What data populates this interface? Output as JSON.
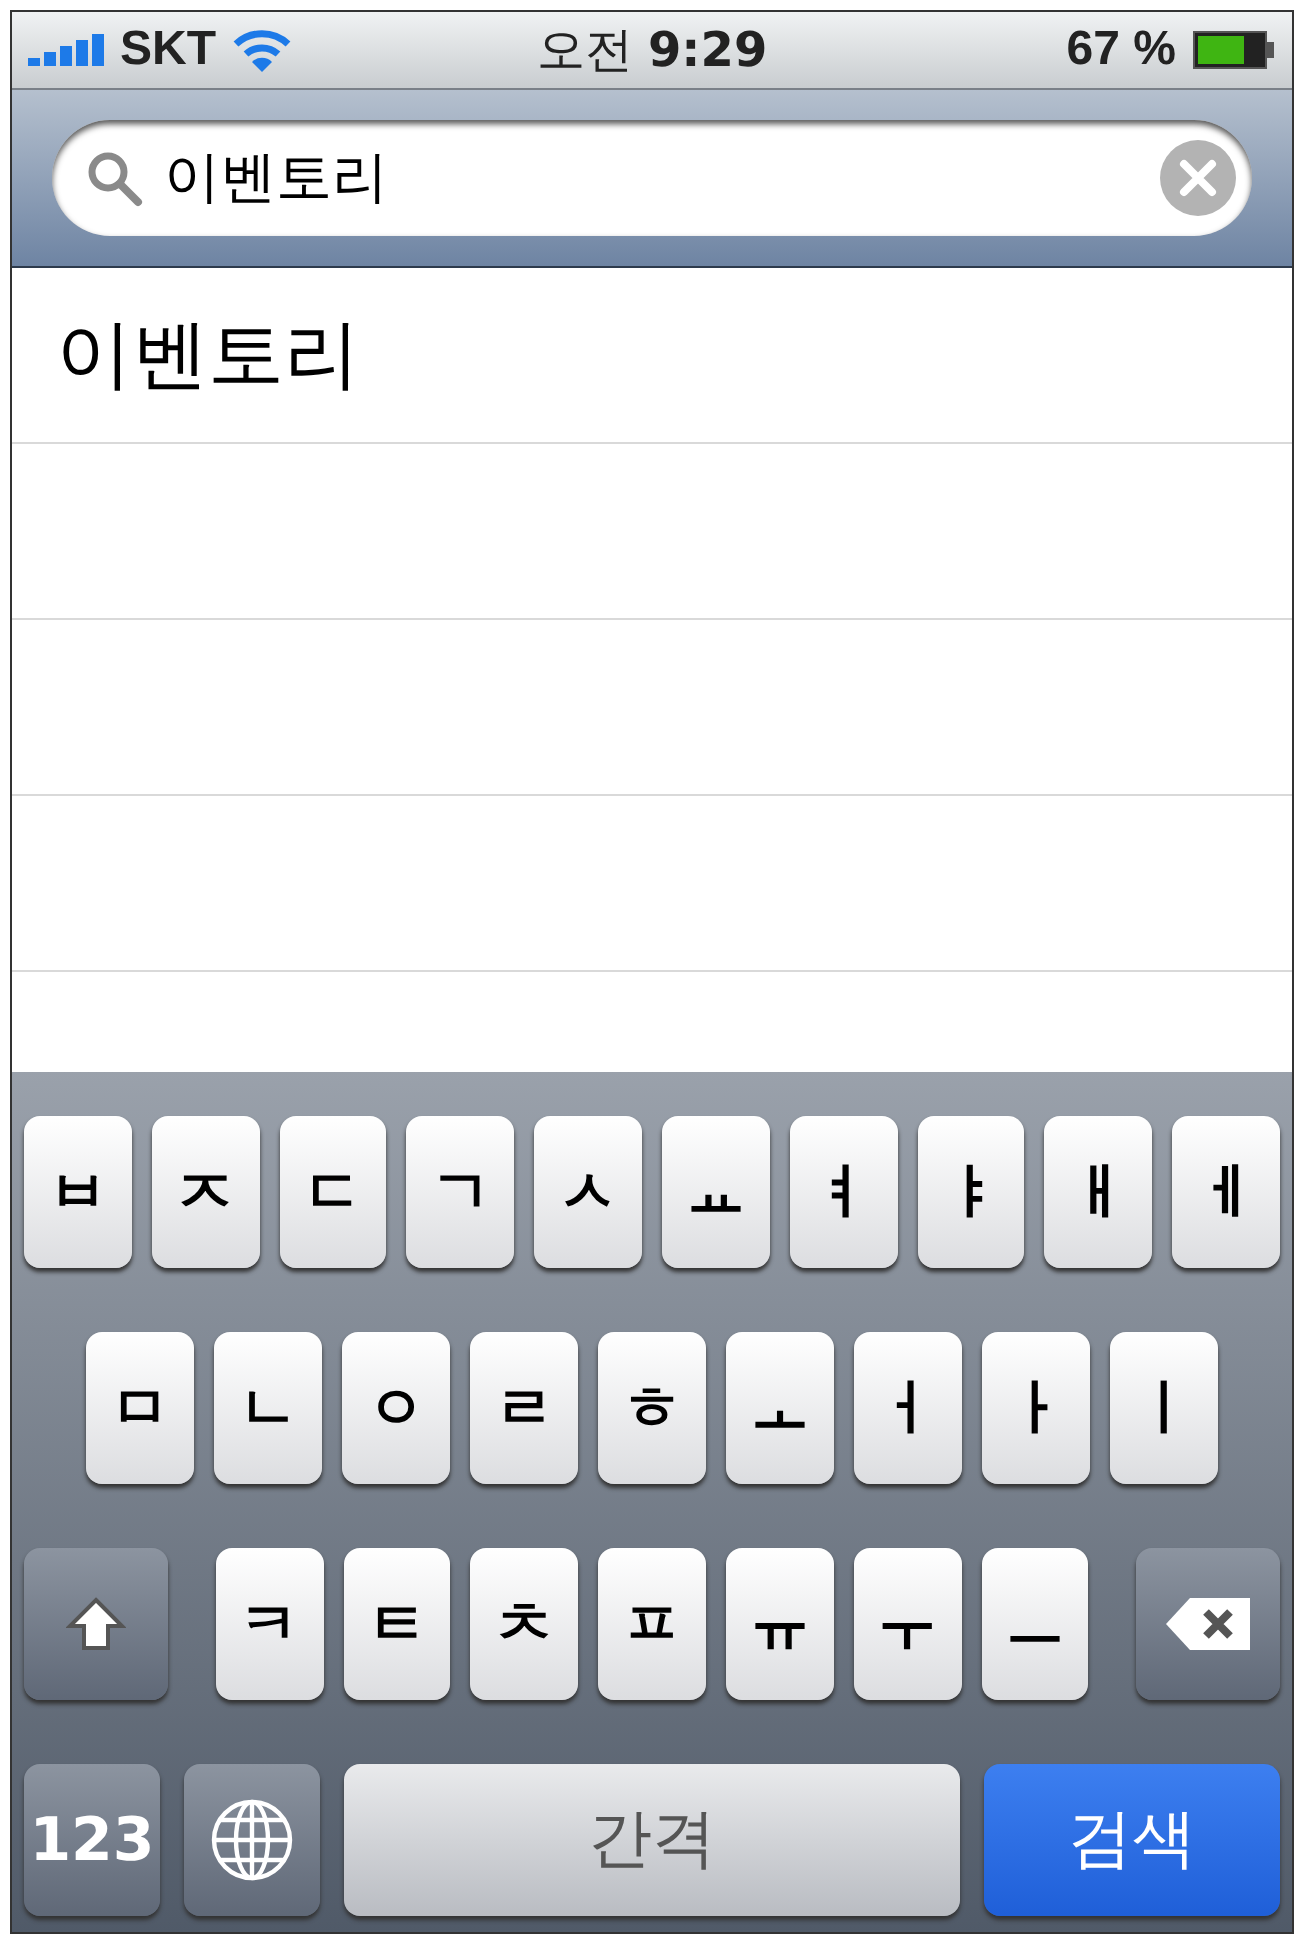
{
  "status_bar": {
    "carrier": "SKT",
    "time": "오전 **9:29**",
    "battery": "67 %"
  },
  "search": {
    "value": "이벤토리"
  },
  "results": [
    {
      "text": "이벤토리"
    }
  ],
  "keyboard": {
    "rows": [
      {
        "keys": [
          {
            "kind": "key",
            "label": "ㅂ"
          },
          {
            "kind": "key",
            "label": "ㅈ"
          },
          {
            "kind": "key",
            "label": "ㄷ"
          },
          {
            "kind": "key",
            "label": "ㄱ"
          },
          {
            "kind": "key",
            "label": "ㅅ"
          },
          {
            "kind": "key",
            "label": "ㅛ"
          },
          {
            "kind": "key",
            "label": "ㅕ"
          },
          {
            "kind": "key",
            "label": "ㅑ"
          },
          {
            "kind": "key",
            "label": "ㅐ"
          },
          {
            "kind": "key",
            "label": "ㅔ"
          }
        ]
      },
      {
        "keys": [
          {
            "kind": "key",
            "label": "ㅁ"
          },
          {
            "kind": "key",
            "label": "ㄴ"
          },
          {
            "kind": "key",
            "label": "ㅇ"
          },
          {
            "kind": "key",
            "label": "ㄹ"
          },
          {
            "kind": "key",
            "label": "ㅎ"
          },
          {
            "kind": "key",
            "label": "ㅗ"
          },
          {
            "kind": "key",
            "label": "ㅓ"
          },
          {
            "kind": "key",
            "label": "ㅏ"
          },
          {
            "kind": "key",
            "label": "ㅣ"
          }
        ]
      },
      {
        "keys": [
          {
            "kind": "shift"
          },
          {
            "kind": "key",
            "label": "ㅋ"
          },
          {
            "kind": "key",
            "label": "ㅌ"
          },
          {
            "kind": "key",
            "label": "ㅊ"
          },
          {
            "kind": "key",
            "label": "ㅍ"
          },
          {
            "kind": "key",
            "label": "ㅠ"
          },
          {
            "kind": "key",
            "label": "ㅜ"
          },
          {
            "kind": "key",
            "label": "ㅡ"
          },
          {
            "kind": "delete"
          }
        ]
      },
      {
        "keys": [
          {
            "kind": "mode",
            "label": "123"
          },
          {
            "kind": "globe"
          },
          {
            "kind": "space",
            "label": "간격"
          },
          {
            "kind": "return",
            "label": "검색"
          }
        ]
      }
    ]
  }
}
